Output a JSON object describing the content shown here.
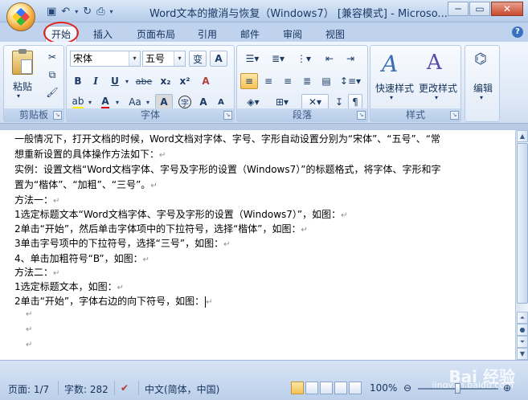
{
  "window": {
    "title": "Word文本的撤消与恢复（Windows7） [兼容模式] - Microso..."
  },
  "tabs": [
    "开始",
    "插入",
    "页面布局",
    "引用",
    "邮件",
    "审阅",
    "视图"
  ],
  "ribbon": {
    "clipboard": {
      "label": "剪贴板",
      "paste": "粘贴"
    },
    "font": {
      "label": "字体",
      "font_name": "宋体",
      "font_size": "五号",
      "bold": "B",
      "italic": "I",
      "underline": "U",
      "strike": "abe",
      "subscript": "x₂",
      "superscript": "x²",
      "clear": "A",
      "phonetic": "变",
      "char_border": "A",
      "grow": "A",
      "shrink": "A",
      "char_shade": "A",
      "enclose": "字"
    },
    "paragraph": {
      "label": "段落"
    },
    "styles": {
      "label": "样式",
      "quick_styles": "快速样式",
      "change_styles": "更改样式"
    },
    "editing": {
      "label": "编辑"
    }
  },
  "document": {
    "lines": [
      "一般情况下，打开文档的时候，Word文档对字体、字号、字形自动设置分别为“宋体”、“五号”、“常",
      "想重新设置的具体操作方法如下：",
      "实例：设置文档“Word文档字体、字号及字形的设置（Windows7）”的标题格式，将字体、字形和字",
      "置为“楷体”、“加粗”、“三号”。",
      "方法一：",
      "1选定标题文本“Word文档字体、字号及字形的设置（Windows7）”，如图：",
      "2单击“开始”，然后单击字体项中的下拉符号，选择“楷体”，如图：",
      "3单击字号项中的下拉符号，选择“三号”，如图：",
      "4、单击加粗符号“B”，如图：",
      "方法二：",
      "1选定标题文本，如图：",
      "2单击“开始”，字体右边的向下符号，如图："
    ],
    "paragraph_mark": "↵"
  },
  "statusbar": {
    "page": "页面: 1/7",
    "words": "字数: 282",
    "language": "中文(简体，中国)",
    "zoom": "100%",
    "watermark": "Bai 经验",
    "watermark_sub": "jingyan.baidu.com"
  }
}
